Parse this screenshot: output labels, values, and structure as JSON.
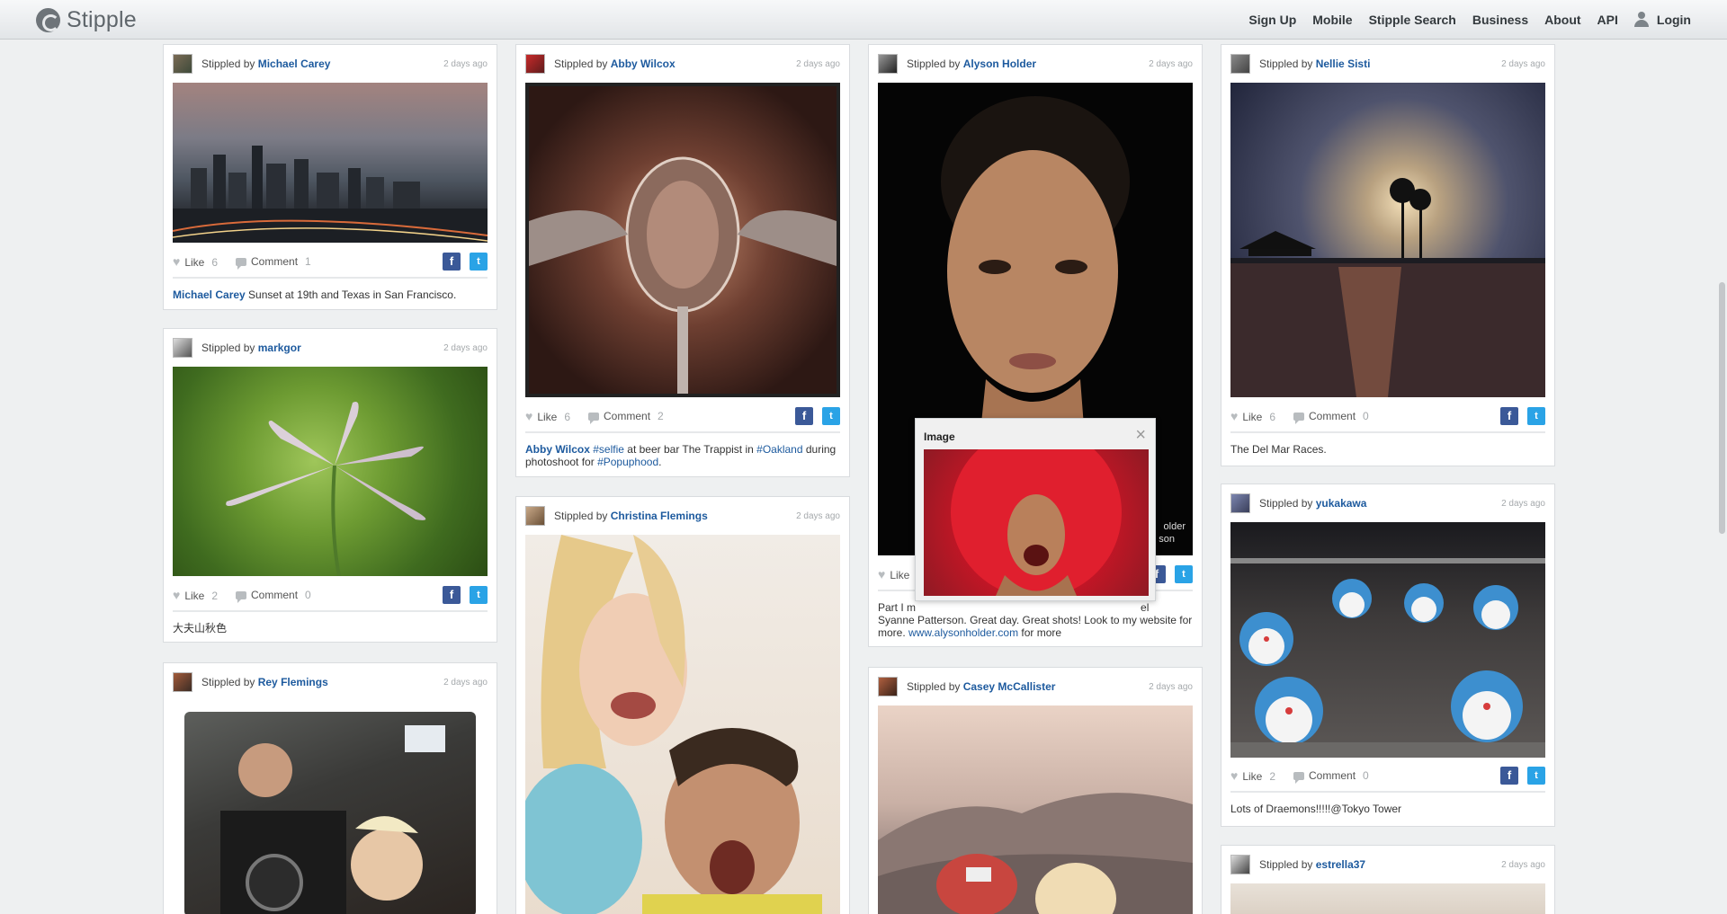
{
  "header": {
    "brand": "Stipple",
    "nav": [
      "Sign Up",
      "Mobile",
      "Stipple Search",
      "Business",
      "About",
      "API",
      "Login"
    ]
  },
  "common": {
    "stippled_by": "Stippled by",
    "like": "Like",
    "comment": "Comment",
    "facebook_icon": "f",
    "twitter_icon": "t",
    "brand_colors": {
      "link": "#1d5a9e",
      "facebook": "#3b5998",
      "twitter": "#2aa3e6"
    }
  },
  "cards": [
    {
      "author": "Michael Carey",
      "time": "2 days ago",
      "likes": "6",
      "comments": "1",
      "caption": {
        "who": "Michael Carey",
        "text": " Sunset at 19th and Texas in San Francisco."
      }
    },
    {
      "author": "markgor",
      "time": "2 days ago",
      "likes": "2",
      "comments": "0",
      "caption": {
        "text": "大夫山秋色"
      }
    },
    {
      "author": "Rey Flemings",
      "time": "2 days ago"
    },
    {
      "author": "Abby Wilcox",
      "time": "2 days ago",
      "likes": "6",
      "comments": "2",
      "caption": {
        "who": "Abby Wilcox",
        "tag1": "#selfie",
        "t1": " at beer bar The Trappist in ",
        "tag2": "#Oakland",
        "t2": " during photoshoot for ",
        "tag3": "#Popuphood",
        "t3": "."
      }
    },
    {
      "author": "Christina Flemings",
      "time": "2 days ago"
    },
    {
      "author": "Alyson Holder",
      "time": "2 days ago",
      "likes": "",
      "caption": {
        "line1": "Part I m",
        "line1b": "el",
        "line2": "Syanne Patterson. Great day. Great shots! Look to my website for",
        "t3": "more. ",
        "link": "www.alysonholder.com",
        "t4": " for more"
      },
      "watermark": "older",
      "watermark2": "son"
    },
    {
      "author": "Casey McCallister",
      "time": "2 days ago"
    },
    {
      "author": "Nellie Sisti",
      "time": "2 days ago",
      "likes": "6",
      "comments": "0",
      "caption": {
        "text": "The Del Mar Races."
      }
    },
    {
      "author": "yukakawa",
      "time": "2 days ago",
      "likes": "2",
      "comments": "0",
      "caption": {
        "text": "Lots of Draemons!!!!!@Tokyo Tower"
      }
    },
    {
      "author": "estrella37",
      "time": "2 days ago"
    }
  ],
  "popup": {
    "title": "Image",
    "close_icon": "×"
  }
}
